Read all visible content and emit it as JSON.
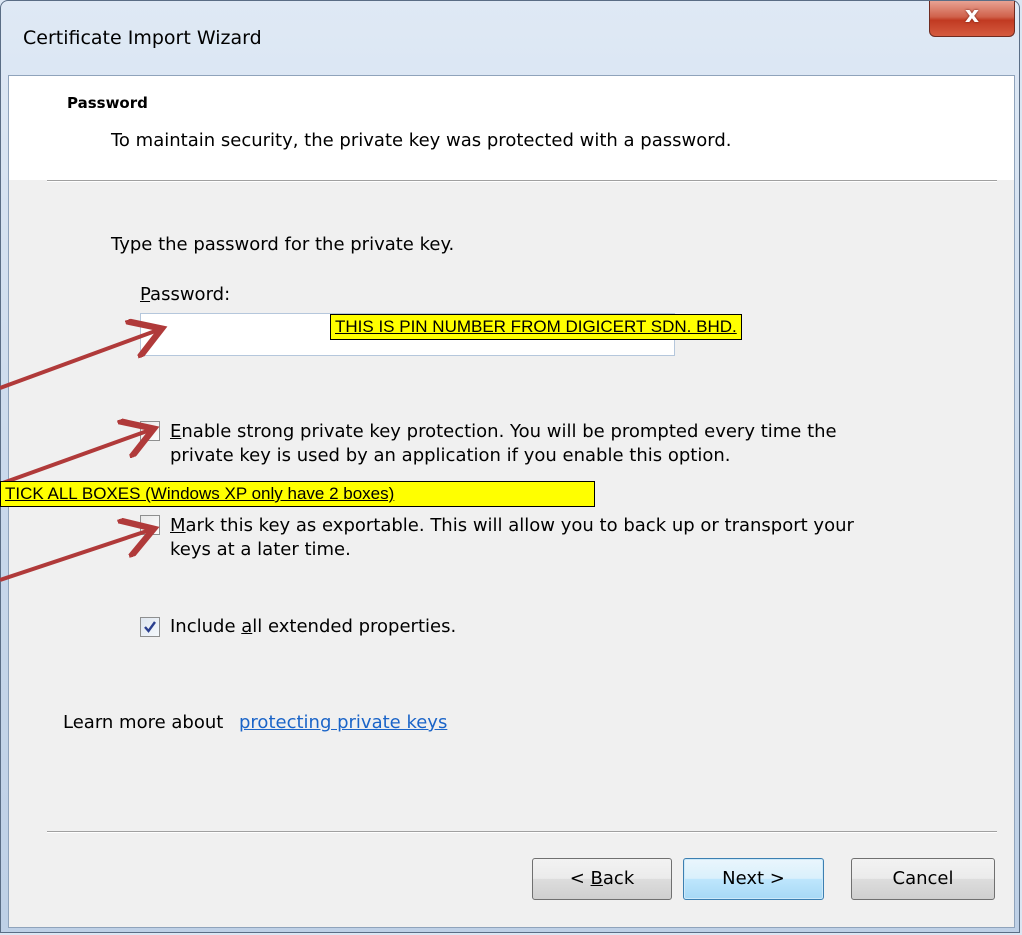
{
  "window": {
    "title": "Certificate Import Wizard",
    "close_glyph": "x"
  },
  "header": {
    "title": "Password",
    "description": "To maintain security, the private key was protected with a password."
  },
  "body": {
    "prompt": "Type the password for the private key.",
    "password_label_prefix": "",
    "password_label_mnemonic": "P",
    "password_label_rest": "assword:",
    "password_value": "",
    "options": [
      {
        "mnemonic": "E",
        "line1_rest": "nable strong private key protection. You will be prompted every time the",
        "line2": "private key is used by an application if you enable this option.",
        "checked": false
      },
      {
        "mnemonic": "M",
        "line1_rest": "ark this key as exportable. This will allow you to back up or transport your",
        "line2": "keys at a later time.",
        "checked": false
      },
      {
        "prefix": "Include ",
        "mnemonic": "a",
        "rest": "ll extended properties.",
        "checked": true
      }
    ],
    "learn_more_text": "Learn more about ",
    "learn_more_link": "protecting private keys"
  },
  "buttons": {
    "back_prefix": "< ",
    "back_mnemonic": "B",
    "back_rest": "ack",
    "next_label": "Next >",
    "cancel_label": "Cancel"
  },
  "annotations": {
    "pin_note": "THIS IS PIN NUMBER FROM DIGICERT SDN. BHD.",
    "tick_note": "TICK ALL BOXES (Windows XP only have 2 boxes)"
  },
  "colors": {
    "callout_bg": "#ffff00",
    "arrow": "#b03a3a",
    "link": "#1a64c8"
  },
  "icons": [
    "close-icon",
    "checkmark-icon",
    "arrow-icon"
  ]
}
